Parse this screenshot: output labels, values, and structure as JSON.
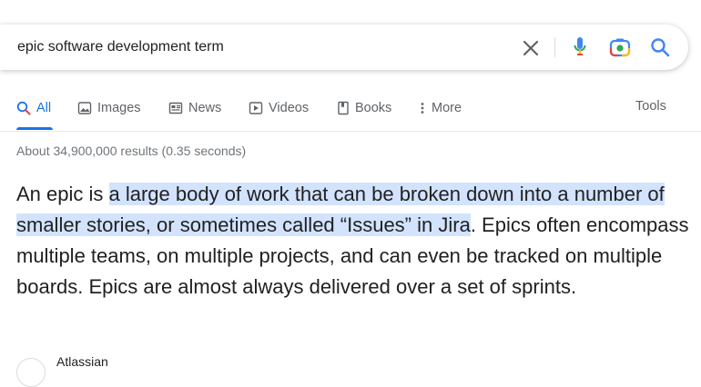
{
  "search": {
    "query": "epic software development term"
  },
  "tabs": [
    {
      "label": "All",
      "icon": "search-icon"
    },
    {
      "label": "Images",
      "icon": "image-icon"
    },
    {
      "label": "News",
      "icon": "newspaper-icon"
    },
    {
      "label": "Videos",
      "icon": "play-icon"
    },
    {
      "label": "Books",
      "icon": "book-icon"
    },
    {
      "label": "More",
      "icon": "more-vertical-icon"
    }
  ],
  "tools_label": "Tools",
  "result_stats": "About 34,900,000 results (0.35 seconds)",
  "featured_snippet": {
    "before_highlight": "An epic is ",
    "highlight": "a large body of work that can be broken down into a number of smaller stories, or sometimes called “Issues” in Jira",
    "after_highlight": ". Epics often encompass multiple teams, on multiple projects, and can even be tracked on multiple boards. Epics are almost always delivered over a set of sprints."
  },
  "source": {
    "name": "Atlassian"
  },
  "colors": {
    "accent": "#1a73e8",
    "highlight": "#d3e3fd",
    "mic_blue": "#4285f4",
    "mic_red": "#ea4335"
  }
}
